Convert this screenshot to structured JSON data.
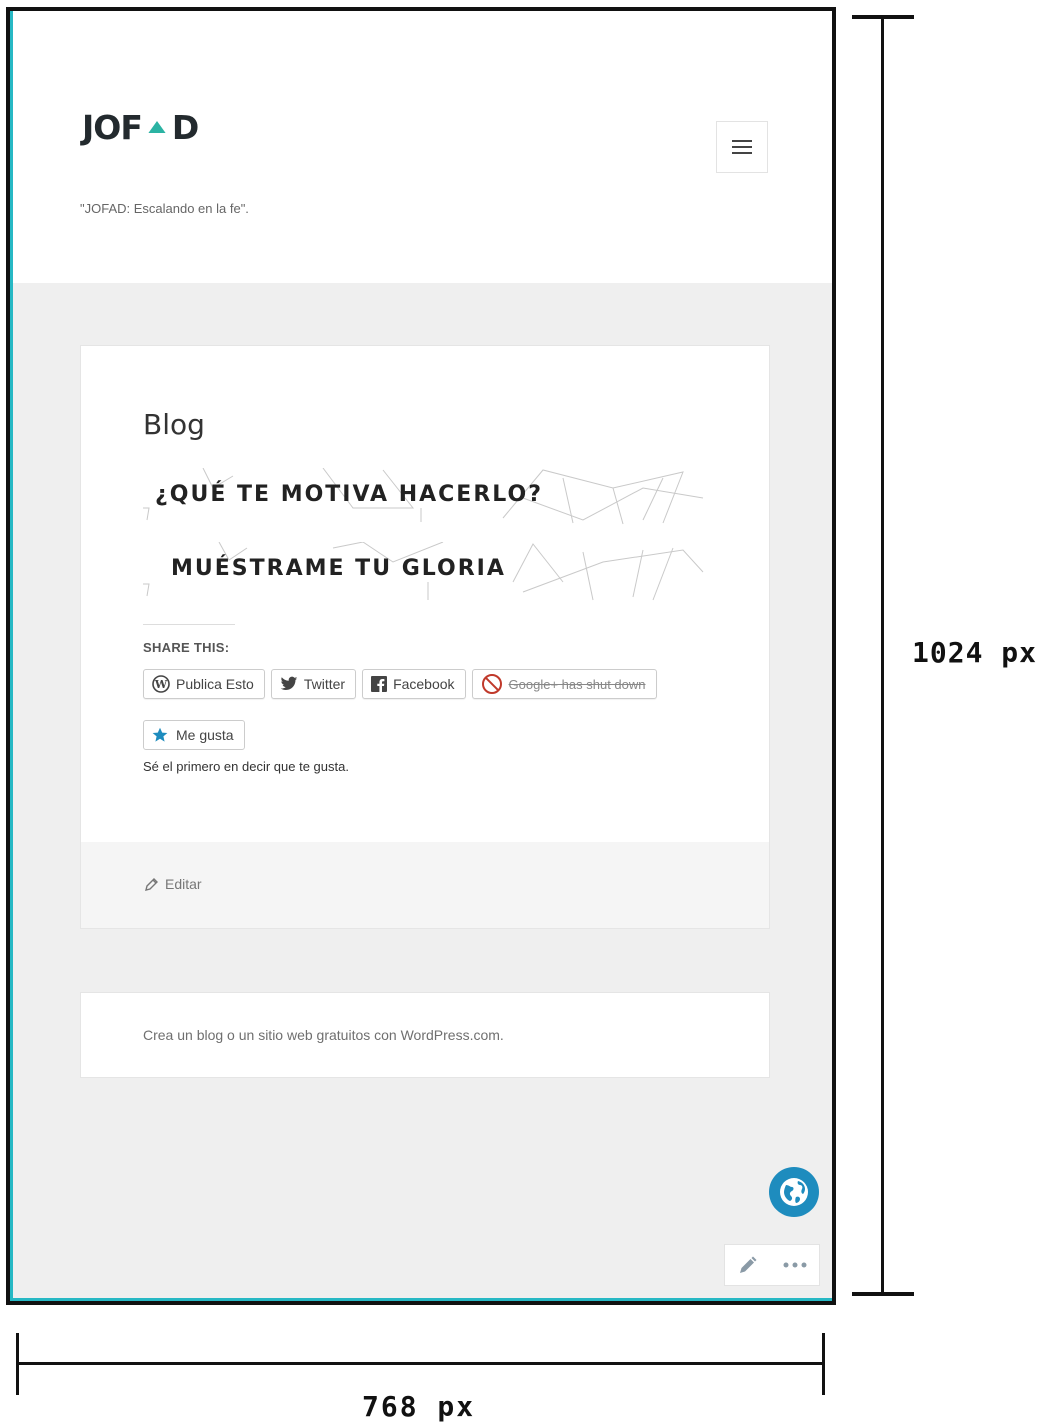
{
  "header": {
    "logo_text_left": "JOF",
    "logo_text_right": "D",
    "tagline": "\"JOFAD: Escalando en la fe\".",
    "menu_icon": "hamburger-menu-icon"
  },
  "post": {
    "title": "Blog",
    "banners": [
      {
        "text": "¿QUÉ TE MOTIVA HACERLO?"
      },
      {
        "text": "MUÉSTRAME TU GLORIA"
      }
    ],
    "share_heading": "SHARE THIS:",
    "share_buttons": [
      {
        "label": "Publica Esto",
        "icon": "wordpress-icon"
      },
      {
        "label": "Twitter",
        "icon": "twitter-icon"
      },
      {
        "label": "Facebook",
        "icon": "facebook-icon"
      },
      {
        "label": "Google+ has shut down",
        "icon": "prohibited-icon",
        "disabled": true
      }
    ],
    "like_label": "Me gusta",
    "like_note": "Sé el primero en decir que te gusta.",
    "edit_label": "Editar"
  },
  "footer": {
    "credit": "Crea un blog o un sitio web gratuitos con WordPress.com."
  },
  "floating": {
    "globe_icon": "globe-icon",
    "edit_icon": "pencil-icon",
    "more_icon": "ellipsis-icon"
  },
  "dimensions": {
    "height_label": "1024 px",
    "width_label": "768 px"
  },
  "colors": {
    "accent_blue": "#1e8cbe",
    "teal_edge": "#27b8c4",
    "logo_triangle": "#2bb3a3",
    "page_bg": "#efefef"
  }
}
